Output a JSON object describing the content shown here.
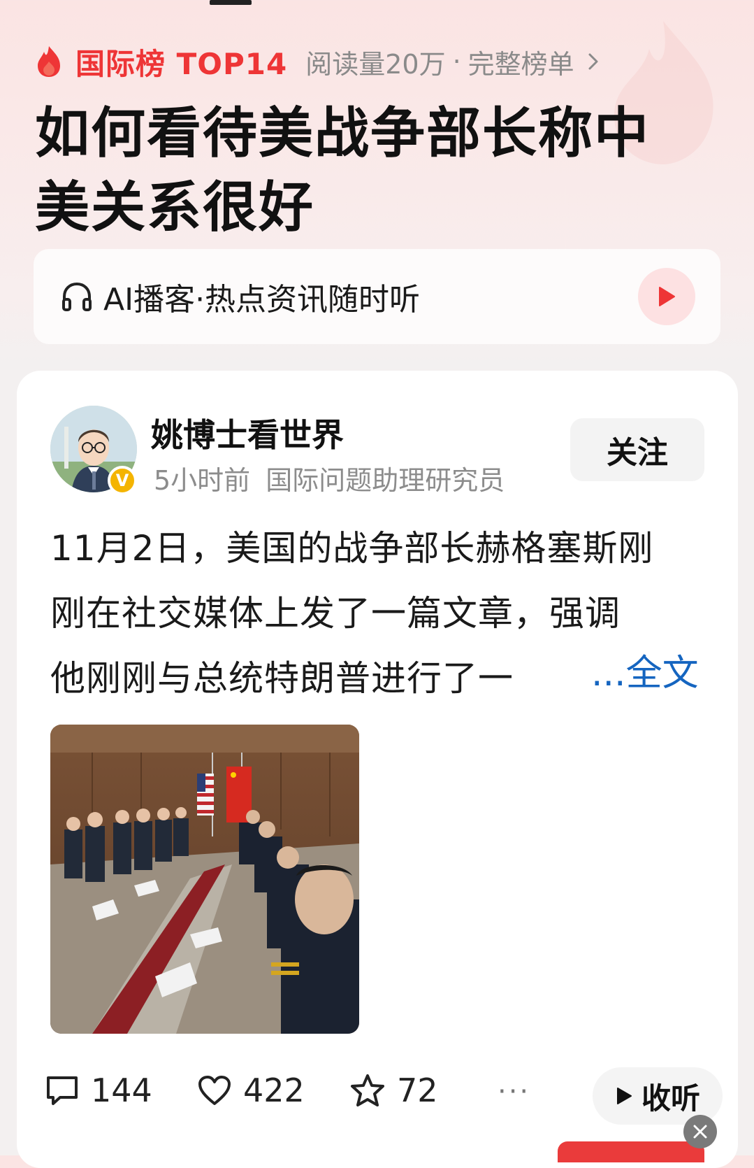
{
  "rank": {
    "label": "国际榜 TOP14",
    "reads": "阅读量20万",
    "separator": "·",
    "full_list": "完整榜单",
    "accent": "#ee3536"
  },
  "headline": "如何看待美战争部长称中美关系很好",
  "podcast": {
    "text": "AI播客·热点资讯随时听",
    "icon": "headphones-icon",
    "play_icon": "play-icon"
  },
  "post": {
    "author": {
      "name": "姚博士看世界",
      "time": "5小时前",
      "title": "国际问题助理研究员",
      "verified_badge": "V"
    },
    "follow_label": "关注",
    "text_lines": [
      "11月2日，美国的战争部长赫格塞斯刚",
      "刚在社交媒体上发了一篇文章，强调",
      "他刚刚与总统特朗普进行了一"
    ],
    "more_label": "...全文",
    "link_color": "#1565c0"
  },
  "actions": {
    "comments": "144",
    "likes": "422",
    "favorites": "72",
    "more": "···",
    "listen_label": "收听"
  }
}
